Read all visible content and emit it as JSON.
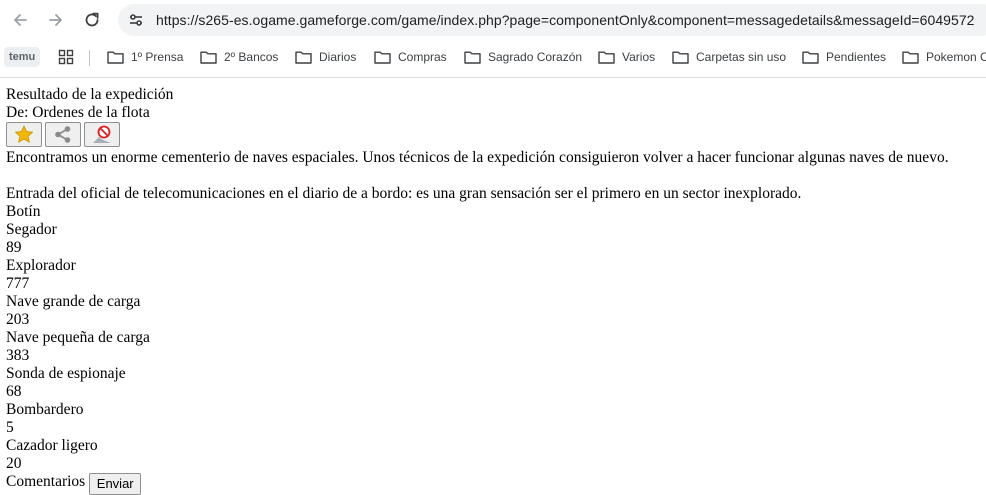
{
  "browser": {
    "url": "https://s265-es.ogame.gameforge.com/game/index.php?page=componentOnly&component=messagedetails&messageId=6049572",
    "bookmarks": [
      {
        "label": "temu"
      },
      {
        "label": "1º Prensa"
      },
      {
        "label": "2º Bancos"
      },
      {
        "label": "Diarios"
      },
      {
        "label": "Compras"
      },
      {
        "label": "Sagrado Corazón"
      },
      {
        "label": "Varios"
      },
      {
        "label": "Carpetas sin uso"
      },
      {
        "label": "Pendientes"
      },
      {
        "label": "Pokemon C"
      }
    ],
    "icons": {
      "back": "arrow-left-icon",
      "forward": "arrow-right-icon",
      "reload": "reload-icon",
      "site_info": "tune-icon",
      "apps": "apps-grid-icon",
      "folder": "folder-icon"
    }
  },
  "message": {
    "title": "Resultado de la expedición",
    "from": "De: Ordenes de la flota",
    "actions": [
      {
        "name": "favorite",
        "icon": "star-icon",
        "color": "#f5b800"
      },
      {
        "name": "share",
        "icon": "share-icon"
      },
      {
        "name": "report",
        "icon": "report-icon",
        "color": "#e21b1b"
      }
    ],
    "body_1": "Encontramos un enorme cementerio de naves espaciales. Unos técnicos de la expedición consiguieron volver a hacer funcionar algunas naves de nuevo.",
    "body_2": "Entrada del oficial de telecomunicaciones en el diario de a bordo: es una gran sensación ser el primero en un sector inexplorado.",
    "loot_label": "Botín",
    "ships": [
      {
        "name": "Segador",
        "count": "89"
      },
      {
        "name": "Explorador",
        "count": "777"
      },
      {
        "name": "Nave grande de carga",
        "count": "203"
      },
      {
        "name": "Nave pequeña de carga",
        "count": "383"
      },
      {
        "name": "Sonda de espionaje",
        "count": "68"
      },
      {
        "name": "Bombardero",
        "count": "5"
      },
      {
        "name": "Cazador ligero",
        "count": "20"
      }
    ],
    "comment_label": "Comentarios",
    "send_label": "Enviar"
  }
}
